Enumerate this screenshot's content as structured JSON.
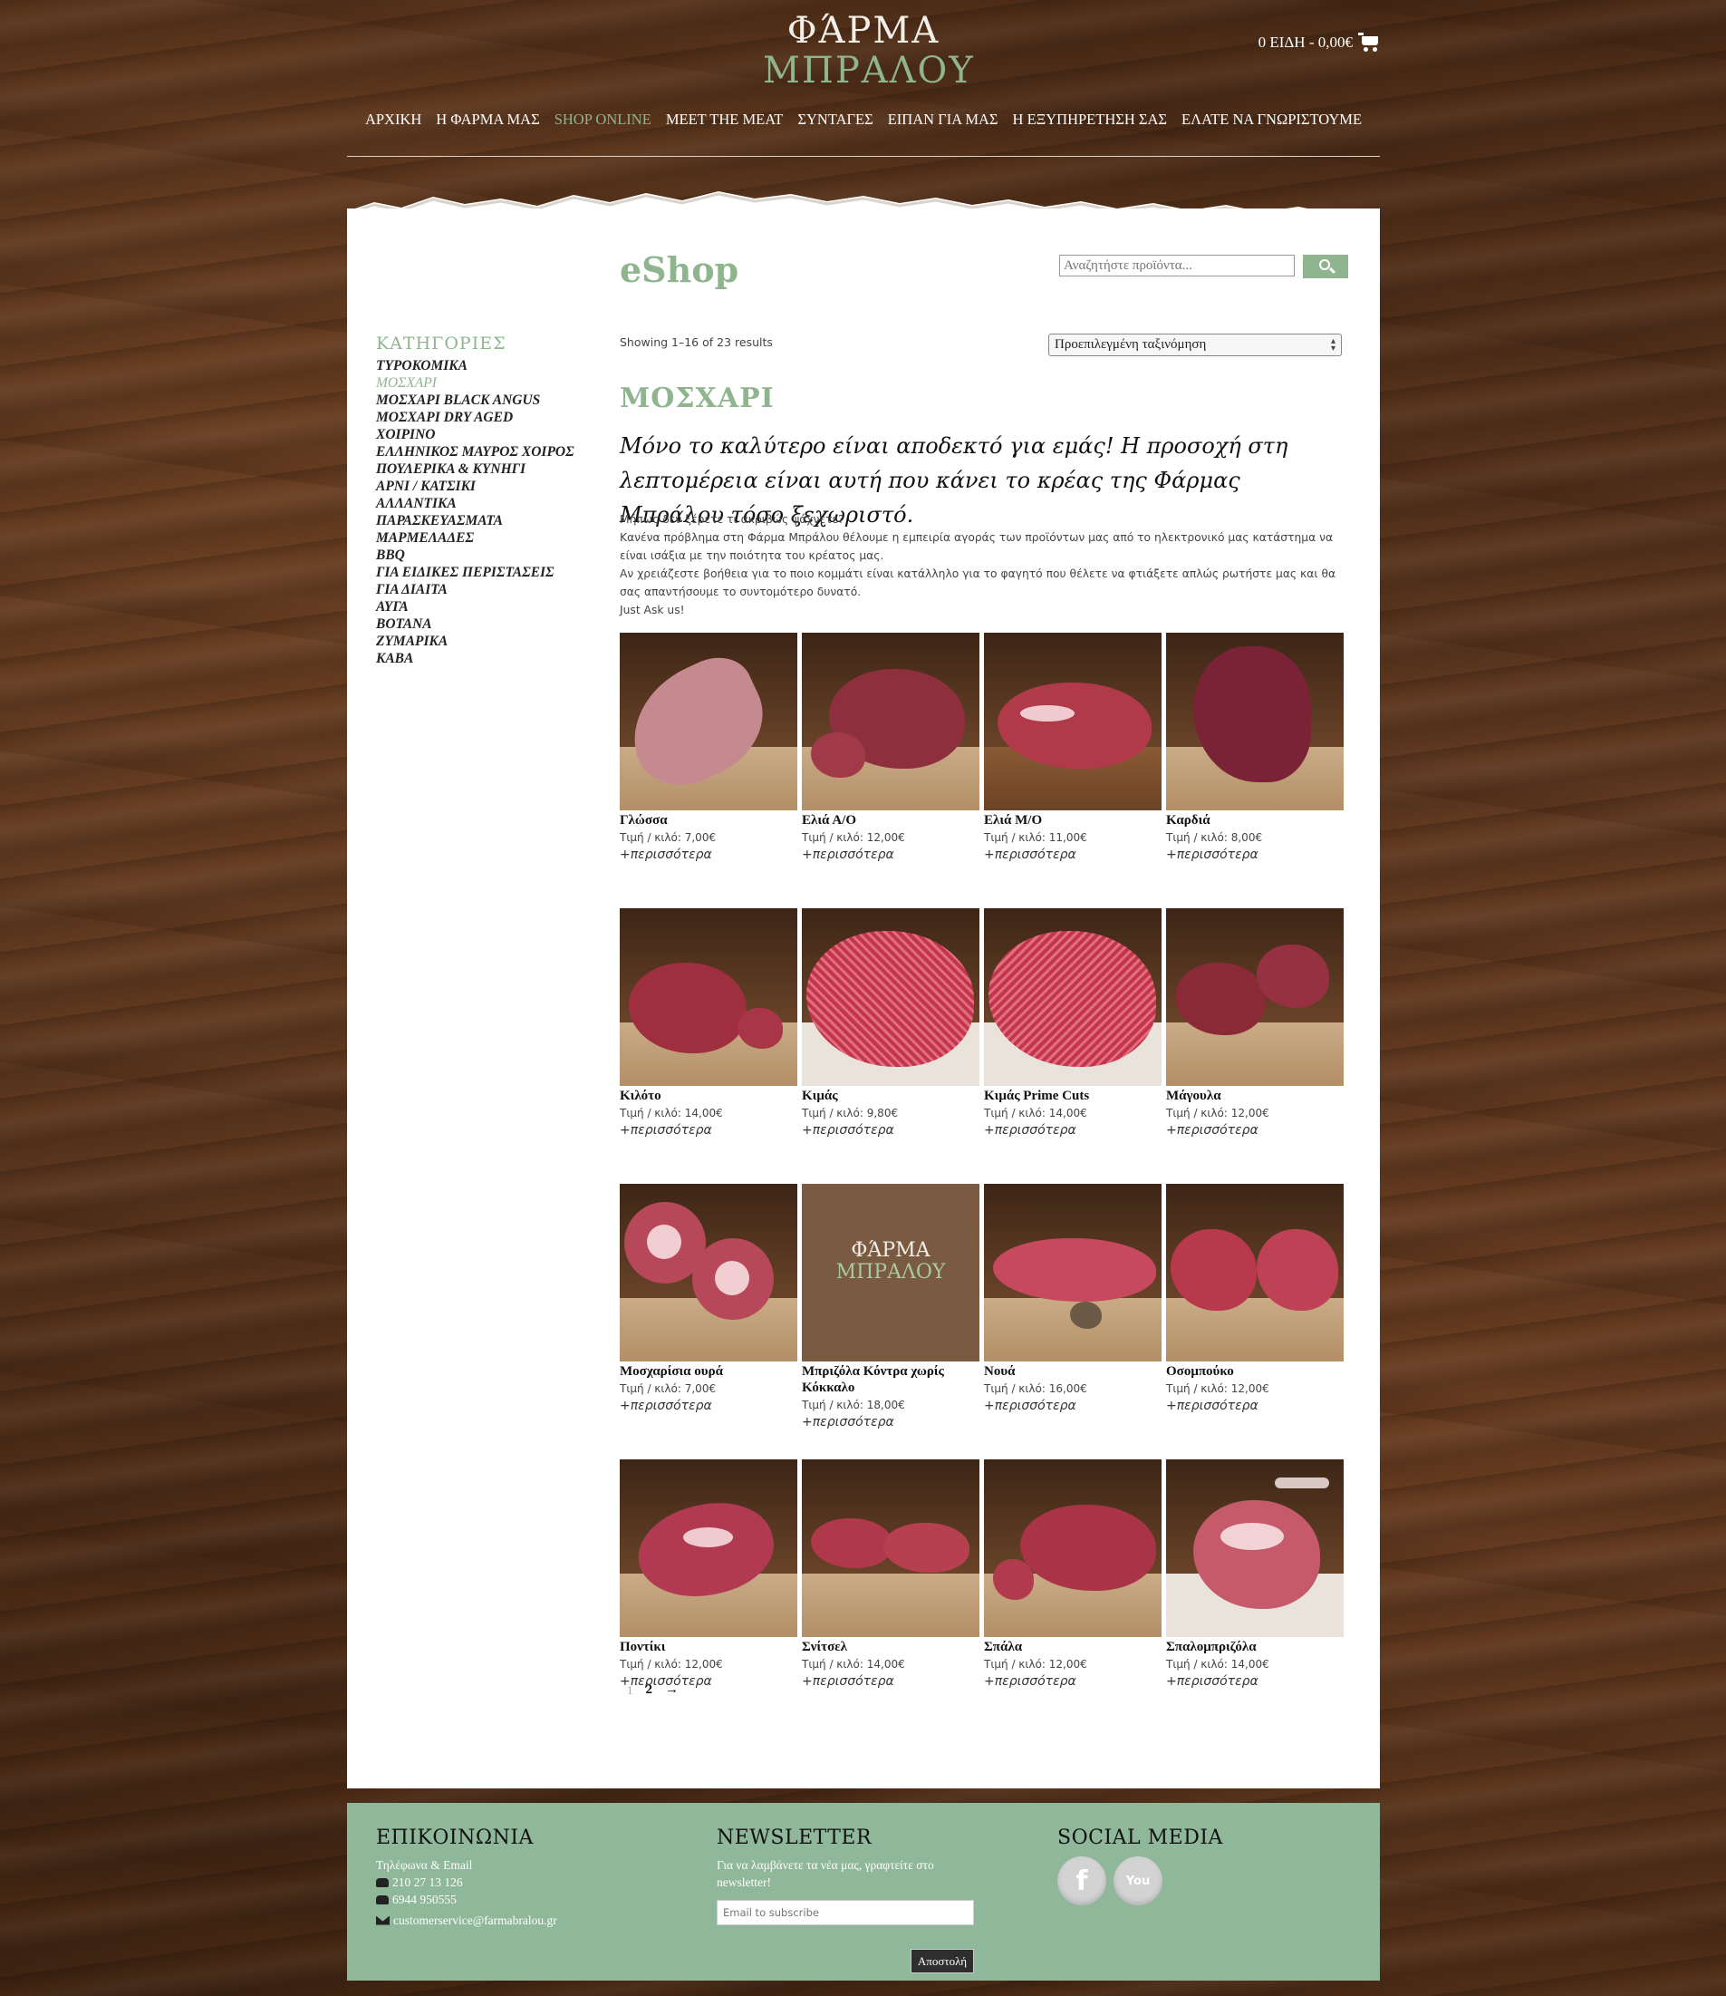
{
  "header": {
    "logo_line1": "ΦΆΡΜΑ",
    "logo_line2": "ΜΠΡΑΛΟΥ",
    "cart_label": "0 ΕΙΔΗ - 0,00€",
    "nav": [
      {
        "label": "ΑΡΧΙΚΗ"
      },
      {
        "label": "Η ΦΑΡΜΑ ΜΑΣ"
      },
      {
        "label": "SHOP ONLINE"
      },
      {
        "label": "MEET THE MEAT"
      },
      {
        "label": "ΣΥΝΤΑΓΕΣ"
      },
      {
        "label": "ΕΙΠΑΝ ΓΙΑ ΜΑΣ"
      },
      {
        "label": "Η ΕΞΥΠΗΡΕΤΗΣΗ ΣΑΣ"
      },
      {
        "label": "ΕΛΑΤΕ ΝΑ ΓΝΩΡΙΣΤΟΥΜΕ"
      }
    ]
  },
  "sidebar": {
    "title": "ΚΑΤΗΓΟΡΙΕΣ",
    "items": [
      {
        "label": "ΤΥΡΟΚΟΜΙΚΑ"
      },
      {
        "label": "ΜΟΣΧΑΡΙ"
      },
      {
        "label": "ΜΟΣΧΑΡΙ BLACK ANGUS"
      },
      {
        "label": "ΜΟΣΧΑΡΙ DRY AGED"
      },
      {
        "label": "ΧΟΙΡΙΝΟ"
      },
      {
        "label": "ΕΛΛΗΝΙΚΟΣ ΜΑΥΡΟΣ ΧΟΙΡΟΣ"
      },
      {
        "label": "ΠΟΥΛΕΡΙΚΑ & ΚΥΝΗΓΙ"
      },
      {
        "label": "ΑΡΝΙ / ΚΑΤΣΙΚΙ"
      },
      {
        "label": "ΑΛΛΑΝΤΙΚΑ"
      },
      {
        "label": "ΠΑΡΑΣΚΕΥΑΣΜΑΤΑ"
      },
      {
        "label": "ΜΑΡΜΕΛΑΔΕΣ"
      },
      {
        "label": "BBQ"
      },
      {
        "label": "ΓΙΑ ΕΙΔΙΚΕΣ ΠΕΡΙΣΤΑΣΕΙΣ"
      },
      {
        "label": "ΓΙΑ ΔΙΑΙΤΑ"
      },
      {
        "label": "ΑΥΓΑ"
      },
      {
        "label": "ΒΟΤΑΝΑ"
      },
      {
        "label": "ΖΥΜΑΡΙΚΑ"
      },
      {
        "label": "ΚΑΒΑ"
      }
    ]
  },
  "main": {
    "title": "eShop",
    "search_placeholder": "Αναζητήστε προϊόντα...",
    "results_text": "Showing 1–16 of 23 results",
    "sort_value": "Προεπιλεγμένη ταξινόμηση",
    "category_title": "ΜΟΣΧΑΡΙ",
    "tagline": "Μόνο το καλύτερο είναι αποδεκτό για εμάς! Η προσοχή στη λεπτομέρεια είναι αυτή που κάνει το κρέας της Φάρμας Μπράλου τόσο ξεχωριστό.",
    "desc_lines": [
      "Μήπως δεν ξέρετε τι ακριβώς ψάχνετε?",
      "Κανένα πρόβλημα στη Φάρμα Μπράλου θέλουμε η εμπειρία αγοράς των προϊόντων μας από το ηλεκτρονικό μας κατάστημα να είναι ισάξια με την ποιότητα του κρέατος μας.",
      "Αν χρειάζεστε βοήθεια για το ποιο κομμάτι είναι κατάλληλο για το φαγητό που θέλετε να φτιάξετε απλώς ρωτήστε μας και θα σας απαντήσουμε το συντομότερο δυνατό.",
      "Just Ask us!"
    ],
    "more_label": "+περισσότερα",
    "products": [
      {
        "name": "Γλώσσα",
        "price": "Τιμή / κιλό: 7,00€"
      },
      {
        "name": "Ελιά Α/Ο",
        "price": "Τιμή / κιλό: 12,00€"
      },
      {
        "name": "Ελιά Μ/Ο",
        "price": "Τιμή / κιλό: 11,00€"
      },
      {
        "name": "Καρδιά",
        "price": "Τιμή / κιλό: 8,00€"
      },
      {
        "name": "Κιλότο",
        "price": "Τιμή / κιλό: 14,00€"
      },
      {
        "name": "Κιμάς",
        "price": "Τιμή / κιλό: 9,80€"
      },
      {
        "name": "Κιμάς Prime Cuts",
        "price": "Τιμή / κιλό: 14,00€"
      },
      {
        "name": "Μάγουλα",
        "price": "Τιμή / κιλό: 12,00€"
      },
      {
        "name": "Μοσχαρίσια ουρά",
        "price": "Τιμή / κιλό: 7,00€"
      },
      {
        "name": "Μπριζόλα Κόντρα χωρίς Κόκκαλο",
        "price": "Τιμή / κιλό: 18,00€"
      },
      {
        "name": "Νουά",
        "price": "Τιμή / κιλό: 16,00€"
      },
      {
        "name": "Οσομπούκο",
        "price": "Τιμή / κιλό: 12,00€"
      },
      {
        "name": "Ποντίκι",
        "price": "Τιμή / κιλό: 12,00€"
      },
      {
        "name": "Σνίτσελ",
        "price": "Τιμή / κιλό: 14,00€"
      },
      {
        "name": "Σπάλα",
        "price": "Τιμή / κιλό: 12,00€"
      },
      {
        "name": "Σπαλομπριζόλα",
        "price": "Τιμή / κιλό: 14,00€"
      }
    ],
    "placeholder_logo_line1": "ΦΆΡΜΑ",
    "placeholder_logo_line2": "ΜΠΡΑΛΟΥ",
    "pager": {
      "current": "1",
      "next_page": "2",
      "next_arrow": "→"
    }
  },
  "footer": {
    "contact_title": "ΕΠΙΚΟΙΝΩΝΙΑ",
    "contact_sub": "Τηλέφωνα & Email",
    "phone1": "210 27 13 126",
    "phone2": "6944 950555",
    "email": "customerservice@farmabralou.gr",
    "newsletter_title": "NEWSLETTER",
    "newsletter_text": "Για να λαμβάνετε τα νέα μας, γραφτείτε στο newsletter!",
    "newsletter_placeholder": "Email to subscribe",
    "newsletter_button": "Αποστολή",
    "social_title": "SOCIAL MEDIA",
    "facebook_glyph": "f",
    "youtube_glyph": "You"
  },
  "colors": {
    "accent": "#8fb58f",
    "footer_bg": "#8fb799",
    "wood": "#4a2b17"
  }
}
